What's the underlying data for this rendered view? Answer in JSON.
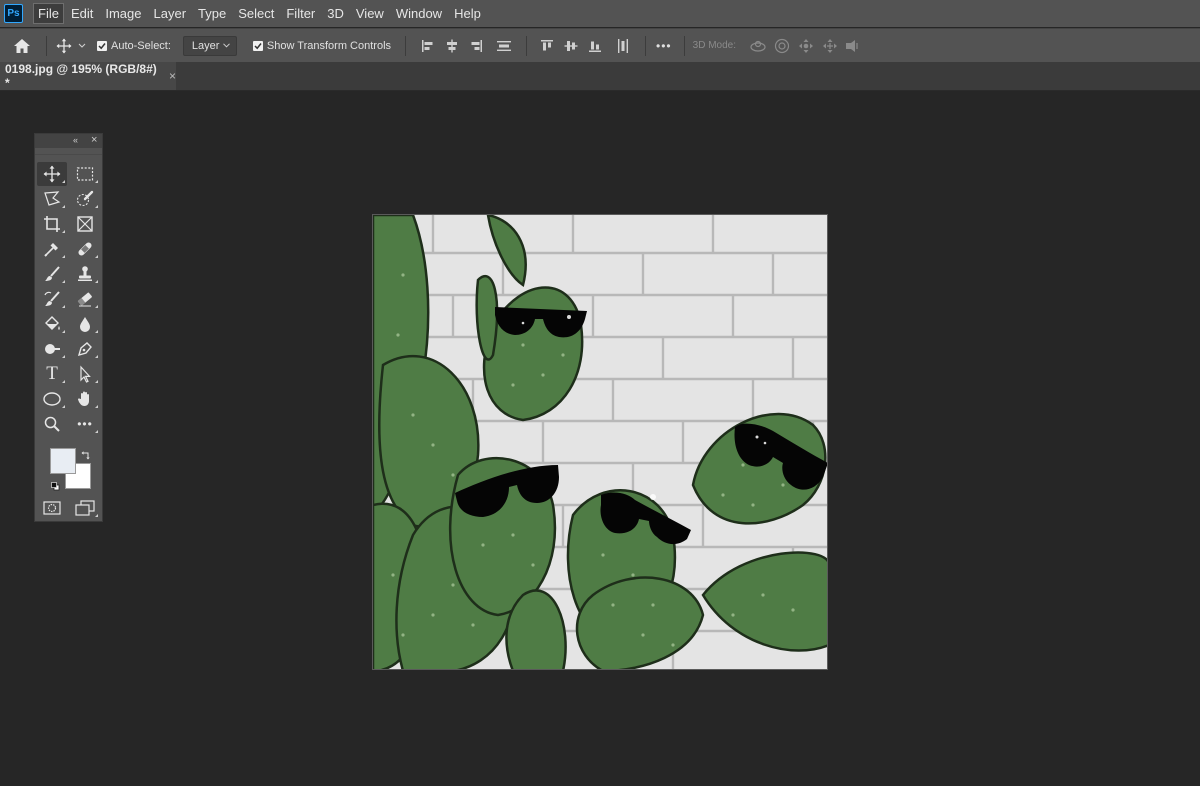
{
  "app": {
    "logo_text": "Ps"
  },
  "menu": {
    "items": [
      "File",
      "Edit",
      "Image",
      "Layer",
      "Type",
      "Select",
      "Filter",
      "3D",
      "View",
      "Window",
      "Help"
    ]
  },
  "options": {
    "auto_select_label": "Auto-Select:",
    "auto_select_value": "Layer",
    "show_transform_label": "Show Transform Controls",
    "more_label": "•••",
    "mode3d_label": "3D Mode:"
  },
  "document": {
    "tab_title": "0198.jpg @ 195% (RGB/8#) *",
    "close_glyph": "×"
  },
  "tools_panel": {
    "collapse_glyph": "«",
    "close_glyph": "×",
    "more_tools_label": "•••",
    "type_tool_label": "T"
  },
  "colors": {
    "accent": "#31a8ff",
    "foreground_swatch": "#e8edf3",
    "background_swatch": "#ffffff"
  }
}
